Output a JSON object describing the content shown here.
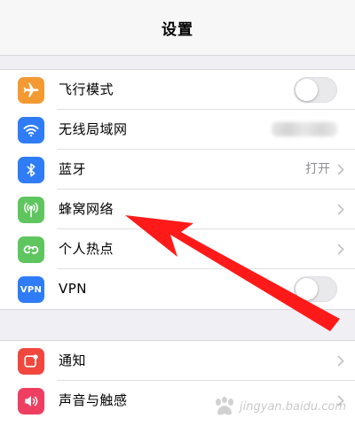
{
  "navbar": {
    "title": "设置"
  },
  "group1": {
    "rows": [
      {
        "label": "飞行模式",
        "icon": "airplane-icon",
        "icon_color": "#f39a33",
        "control": "toggle",
        "toggle_on": false
      },
      {
        "label": "无线局域网",
        "icon": "wifi-icon",
        "icon_color": "#2f7cf6",
        "control": "value-blurred"
      },
      {
        "label": "蓝牙",
        "icon": "bluetooth-icon",
        "icon_color": "#2f7cf6",
        "value": "打开",
        "control": "chevron"
      },
      {
        "label": "蜂窝网络",
        "icon": "antenna-icon",
        "icon_color": "#5fc65f",
        "control": "chevron"
      },
      {
        "label": "个人热点",
        "icon": "hotspot-icon",
        "icon_color": "#5fc65f",
        "control": "chevron"
      },
      {
        "label": "VPN",
        "icon": "vpn-icon",
        "icon_label": "VPN",
        "icon_color": "#2f7cf6",
        "control": "toggle",
        "toggle_on": false
      }
    ]
  },
  "group2": {
    "rows": [
      {
        "label": "通知",
        "icon": "notification-icon",
        "icon_color": "#f0483e",
        "control": "chevron"
      },
      {
        "label": "声音与触感",
        "icon": "sound-icon",
        "icon_color": "#ee3f62",
        "control": "chevron"
      }
    ]
  },
  "annotation": {
    "color": "#ff1a1a",
    "points_to": "蜂窝网络"
  },
  "watermark": {
    "text": "jingyan.baidu.com"
  }
}
